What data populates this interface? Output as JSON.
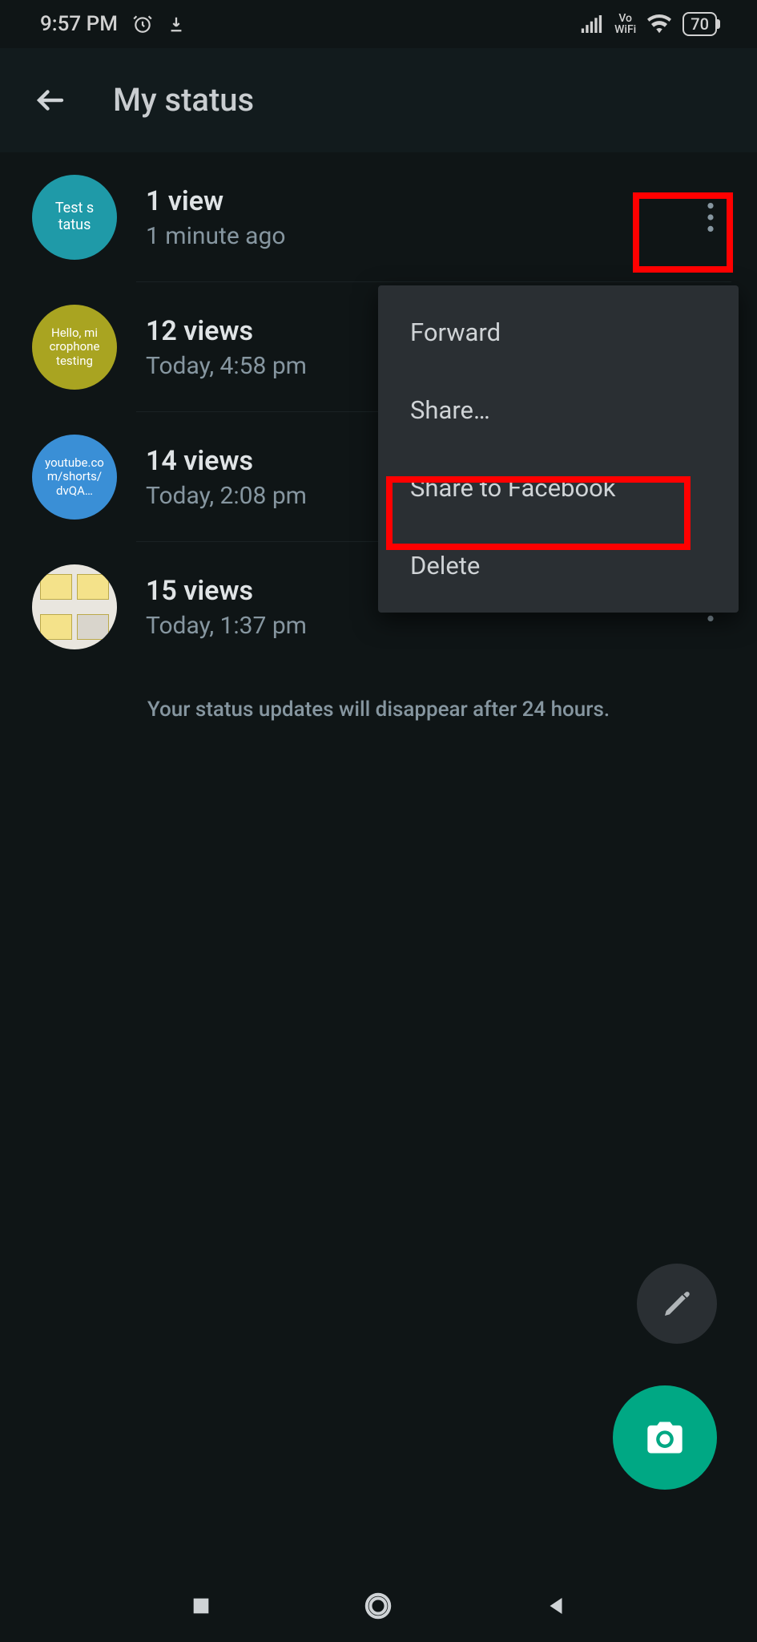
{
  "statusbar": {
    "time": "9:57 PM",
    "battery": "70",
    "vowifi_top": "Vo",
    "vowifi_bottom": "WiFi"
  },
  "appbar": {
    "title": "My status"
  },
  "statuses": [
    {
      "thumb_text": "Test s\ntatus",
      "thumb_class": "teal",
      "views": "1 view",
      "time": "1 minute ago"
    },
    {
      "thumb_text": "Hello, mi\ncrophone\ntesting",
      "thumb_class": "olive",
      "views": "12 views",
      "time": "Today, 4:58 pm"
    },
    {
      "thumb_text": "youtube.co\nm/shorts/\ndvQA…",
      "thumb_class": "blue",
      "views": "14 views",
      "time": "Today, 2:08 pm"
    },
    {
      "thumb_text": "",
      "thumb_class": "image",
      "views": "15 views",
      "time": "Today, 1:37 pm"
    }
  ],
  "menu": {
    "items": [
      "Forward",
      "Share…",
      "Share to Facebook",
      "Delete"
    ]
  },
  "footer_note": "Your status updates will disappear after 24 hours.",
  "icons": {
    "back": "back-arrow-icon",
    "alarm": "alarm-icon",
    "download": "download-icon",
    "signal": "signal-icon",
    "wifi": "wifi-icon",
    "more": "more-vertical-icon",
    "pencil": "pencil-icon",
    "camera": "camera-icon",
    "nav_recent": "square-icon",
    "nav_home": "circle-icon",
    "nav_back": "triangle-icon"
  },
  "colors": {
    "accent": "#00a884",
    "highlight": "#ff0000"
  }
}
